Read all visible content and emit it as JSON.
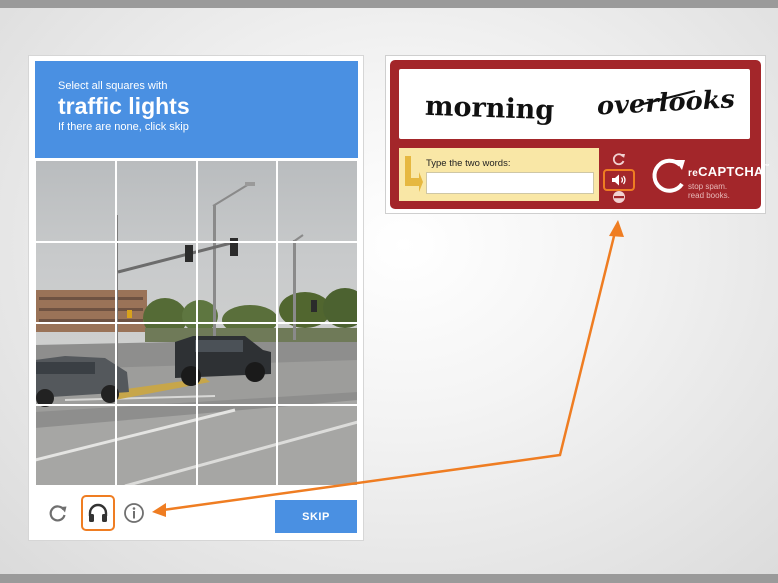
{
  "image_captcha": {
    "instruction_top": "Select all squares with",
    "target": "traffic lights",
    "instruction_bottom": "If there are none, click skip",
    "skip_label": "SKIP",
    "tile_count": 16
  },
  "classic_captcha": {
    "challenge_words": [
      "morning",
      "overlooks"
    ],
    "entry_label": "Type the two words:",
    "entry_value": "",
    "brand_prefix": "re",
    "brand_name": "CAPTCHA",
    "brand_tm": "™",
    "tagline_line1": "stop spam.",
    "tagline_line2": "read books."
  },
  "colors": {
    "header_blue": "#4a90e2",
    "highlight_orange": "#ef7d22",
    "classic_red": "#a3262a",
    "entry_yellow": "#f9e7a6"
  },
  "icons": {
    "reload": "reload-icon",
    "audio": "headphones-icon",
    "info": "info-icon",
    "classic_refresh": "refresh-icon",
    "classic_audio": "speaker-icon",
    "classic_help": "help-icon",
    "brand_logo": "recaptcha-logo-icon"
  }
}
